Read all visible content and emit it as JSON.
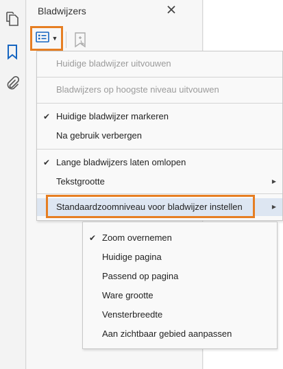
{
  "panel": {
    "title": "Bladwijzers",
    "close_icon": "close-icon"
  },
  "rail": {
    "icons": [
      "pages-icon",
      "bookmark-icon",
      "attachment-icon"
    ],
    "accent": "#1565c0"
  },
  "toolbar": {
    "options_icon": "options-list-icon",
    "new_bookmark_icon": "bookmark-action-icon"
  },
  "menu": {
    "items": [
      {
        "label": "Huidige bladwijzer uitvouwen",
        "disabled": true
      },
      {
        "label": "Bladwijzers op hoogste niveau uitvouwen",
        "disabled": true
      },
      {
        "label": "Huidige bladwijzer markeren",
        "checked": true
      },
      {
        "label": "Na gebruik verbergen"
      },
      {
        "label": "Lange bladwijzers laten omlopen",
        "checked": true
      },
      {
        "label": "Tekstgrootte",
        "submenu": true
      },
      {
        "label": "Standaardzoomniveau voor bladwijzer instellen",
        "submenu": true,
        "active": true
      }
    ]
  },
  "submenu": {
    "items": [
      {
        "label": "Zoom overnemen",
        "checked": true
      },
      {
        "label": "Huidige pagina"
      },
      {
        "label": "Passend op pagina"
      },
      {
        "label": "Ware grootte"
      },
      {
        "label": "Vensterbreedte"
      },
      {
        "label": "Aan zichtbaar gebied aanpassen"
      }
    ]
  },
  "colors": {
    "highlight_border": "#e67e22",
    "active_row": "#dde6f2",
    "disabled_text": "#9b9b9b"
  }
}
